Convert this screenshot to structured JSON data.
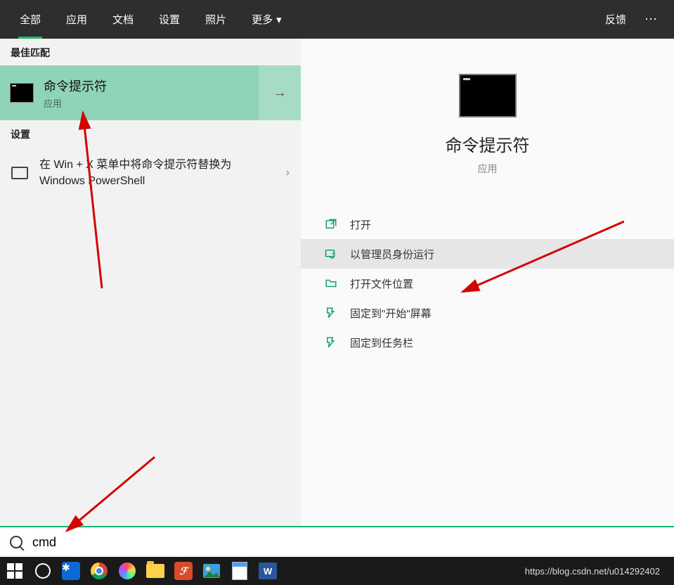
{
  "header": {
    "tabs": [
      "全部",
      "应用",
      "文档",
      "设置",
      "照片"
    ],
    "more": "更多",
    "feedback": "反馈"
  },
  "left": {
    "best_match_header": "最佳匹配",
    "best_match": {
      "title": "命令提示符",
      "subtitle": "应用"
    },
    "settings_header": "设置",
    "settings_item": "在 Win + X 菜单中将命令提示符替换为 Windows PowerShell"
  },
  "preview": {
    "title": "命令提示符",
    "subtitle": "应用",
    "actions": {
      "open": "打开",
      "run_admin": "以管理员身份运行",
      "open_location": "打开文件位置",
      "pin_start": "固定到\"开始\"屏幕",
      "pin_taskbar": "固定到任务栏"
    }
  },
  "search": {
    "value": "cmd"
  },
  "taskbar": {
    "word": "W",
    "url": "https://blog.csdn.net/u014292402"
  }
}
